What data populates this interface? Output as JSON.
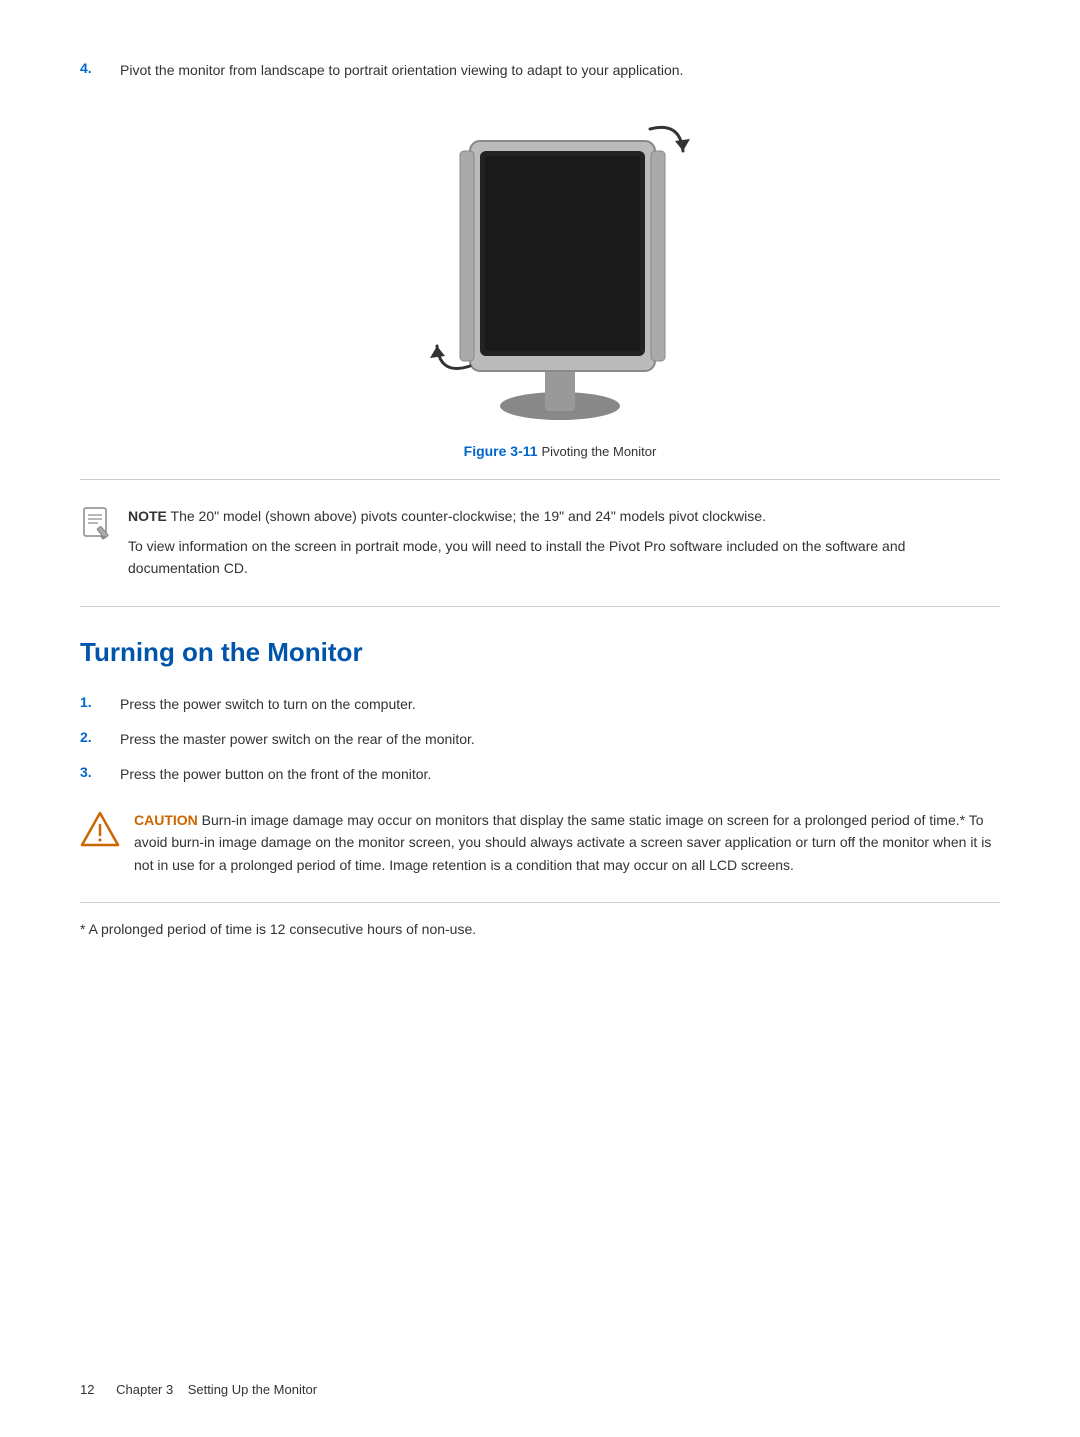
{
  "page": {
    "footer": {
      "page_number": "12",
      "chapter": "Chapter 3",
      "section": "Setting Up the Monitor"
    }
  },
  "step4": {
    "text": "Pivot the monitor from landscape to portrait orientation viewing to adapt to your application."
  },
  "figure": {
    "label": "Figure 3-11",
    "caption": "Pivoting the Monitor"
  },
  "note": {
    "label": "NOTE",
    "text": "The 20\" model (shown above) pivots counter-clockwise; the 19\" and 24\" models pivot clockwise.",
    "paragraph": "To view information on the screen in portrait mode, you will need to install the Pivot Pro software included on the software and documentation CD."
  },
  "section_title": "Turning on the Monitor",
  "steps": [
    {
      "number": "1.",
      "text": "Press the power switch to turn on the computer."
    },
    {
      "number": "2.",
      "text": "Press the master power switch on the rear of the monitor."
    },
    {
      "number": "3.",
      "text": "Press the power button on the front of the monitor."
    }
  ],
  "caution": {
    "label": "CAUTION",
    "text": "Burn-in image damage may occur on monitors that display the same static image on screen for a prolonged period of time.* To avoid burn-in image damage on the monitor screen, you should always activate a screen saver application or turn off the monitor when it is not in use for a prolonged period of time. Image retention is a condition that may occur on all LCD screens."
  },
  "footnote": {
    "text": "* A prolonged period of time is 12 consecutive hours of non-use."
  }
}
